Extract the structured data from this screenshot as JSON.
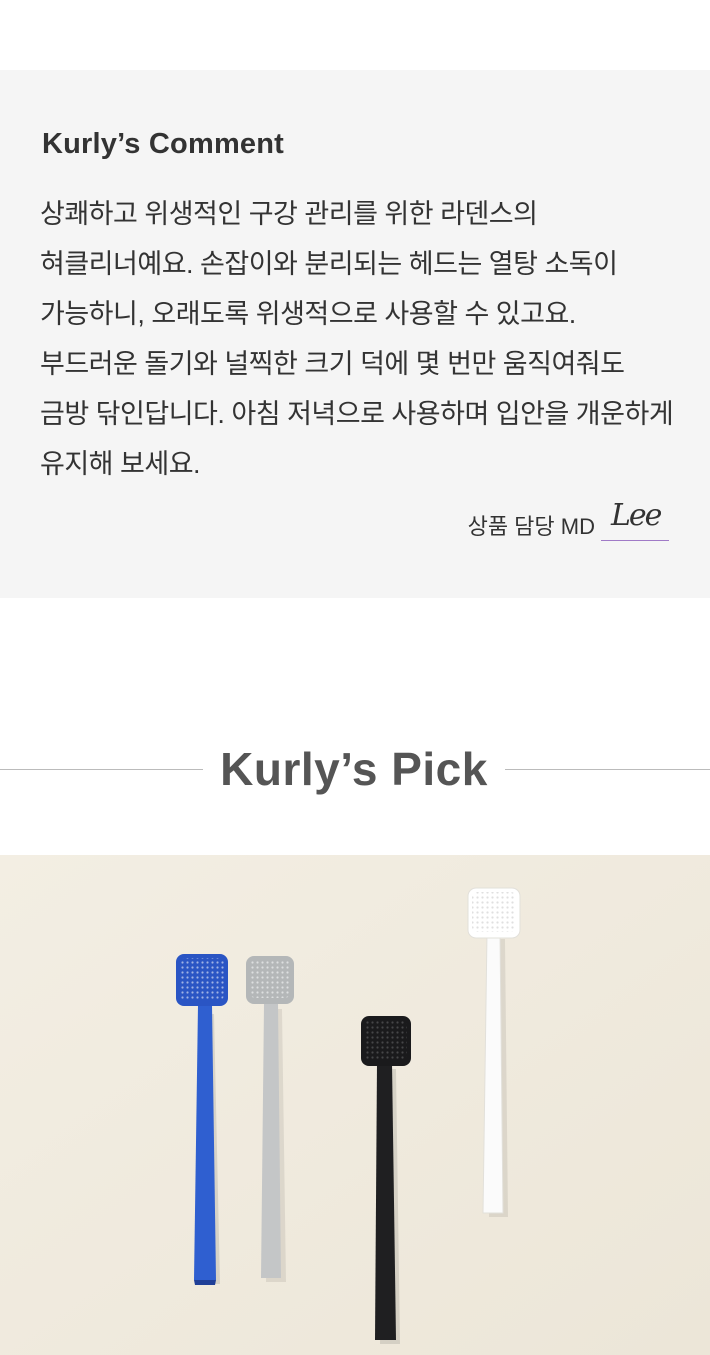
{
  "comment": {
    "title": "Kurly’s Comment",
    "body": "상쾌하고 위생적인 구강 관리를 위한 라덴스의 혀클리너예요. 손잡이와 분리되는 헤드는 열탕 소독이 가능하니, 오래도록 위생적으로 사용할 수 있고요. 부드러운 돌기와 널찍한 크기 덕에 몇 번만 움직여줘도 금방 닦인답니다. 아침 저녁으로 사용하며 입안을 개운하게 유지해 보세요.",
    "md_label": "상품 담당 MD",
    "md_signature": "Lee",
    "signature_color": "#a07ac7",
    "background_color": "#f5f5f5"
  },
  "pick": {
    "title": "Kurly’s Pick"
  },
  "product_photo": {
    "background_color": "#f1ece0",
    "items": [
      {
        "name": "blue-tongue-cleaner",
        "color": "#2f5fd0"
      },
      {
        "name": "gray-tongue-cleaner",
        "color": "#b9bcbd"
      },
      {
        "name": "black-tongue-cleaner",
        "color": "#1c1c1e"
      },
      {
        "name": "white-tongue-cleaner",
        "color": "#fbfbfb"
      }
    ]
  }
}
